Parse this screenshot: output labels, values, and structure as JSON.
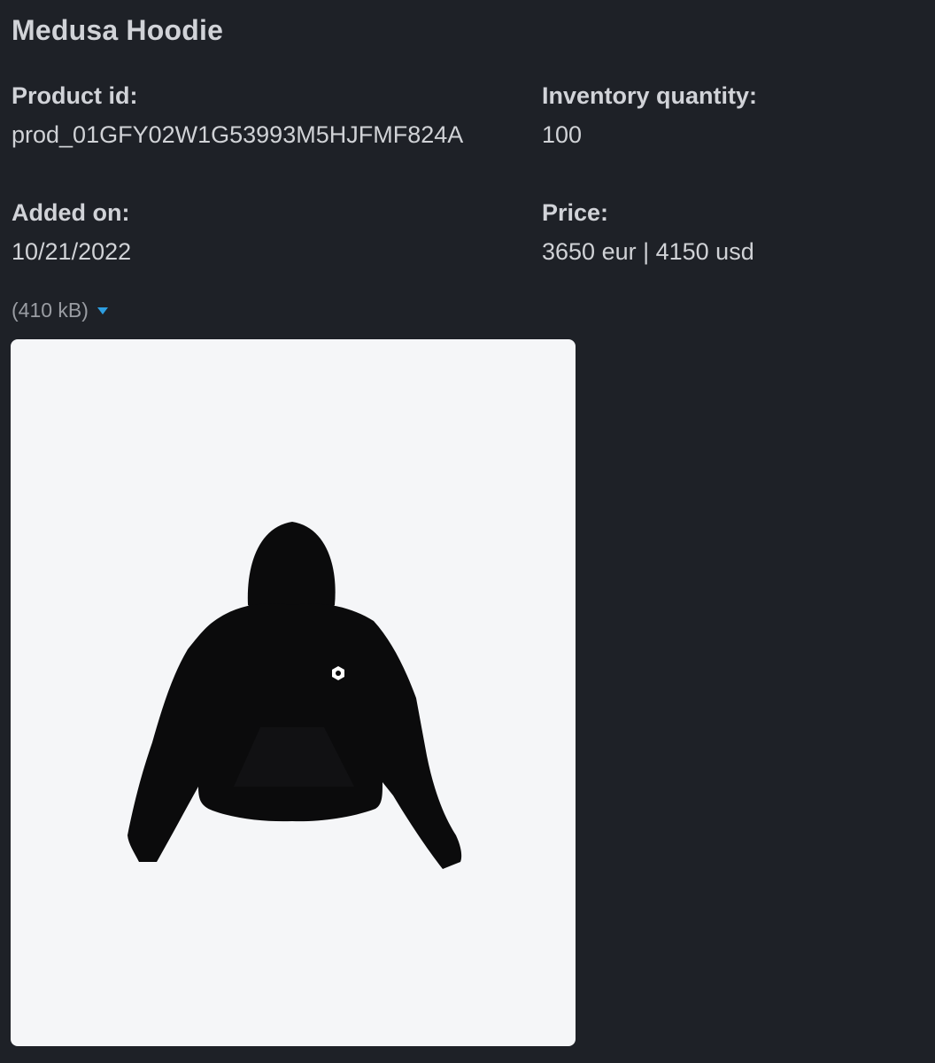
{
  "product": {
    "title": "Medusa Hoodie",
    "product_id_label": "Product id:",
    "product_id": "prod_01GFY02W1G53993M5HJFMF824A",
    "inventory_label": "Inventory quantity:",
    "inventory": "100",
    "added_label": "Added on:",
    "added": "10/21/2022",
    "price_label": "Price:",
    "price": "3650 eur | 4150 usd"
  },
  "attachment": {
    "size": "(410 kB)",
    "toggle_icon": "caret-down-icon",
    "image_subject": "black hoodie with white hexagon logo"
  },
  "colors": {
    "background": "#1e2127",
    "accent": "#2d9ee0",
    "image_bg": "#f5f6f8"
  }
}
